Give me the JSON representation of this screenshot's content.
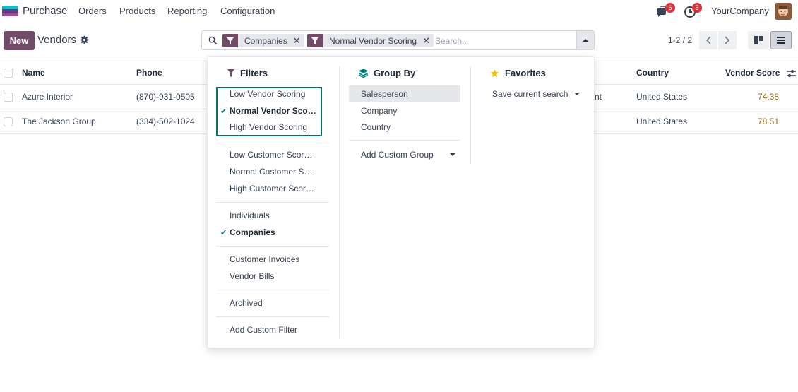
{
  "nav": {
    "app_name": "Purchase",
    "menu": [
      "Orders",
      "Products",
      "Reporting",
      "Configuration"
    ],
    "messages_count": "6",
    "activities_count": "5",
    "company": "YourCompany"
  },
  "control": {
    "new_label": "New",
    "title": "Vendors",
    "facets": [
      "Companies",
      "Normal Vendor Scoring"
    ],
    "search_placeholder": "Search...",
    "pager": "1-2 / 2"
  },
  "list": {
    "columns": [
      "Name",
      "Phone",
      "Country",
      "Vendor Score"
    ],
    "rows": [
      {
        "name": "Azure Interior",
        "phone": "(870)-931-0505",
        "hidden_partial": "nt",
        "country": "United States",
        "score": "74.38"
      },
      {
        "name": "The Jackson Group",
        "phone": "(334)-502-1024",
        "hidden_partial": "",
        "country": "United States",
        "score": "78.51"
      }
    ]
  },
  "dropdown": {
    "filters_title": "Filters",
    "filters": {
      "vendor": [
        "Low Vendor Scoring",
        "Normal Vendor Sco…",
        "High Vendor Scoring"
      ],
      "customer": [
        "Low Customer Scor…",
        "Normal Customer S…",
        "High Customer Scor…"
      ],
      "type": [
        "Individuals",
        "Companies"
      ],
      "docs": [
        "Customer Invoices",
        "Vendor Bills"
      ],
      "archived": "Archived",
      "add_custom": "Add Custom Filter"
    },
    "groupby_title": "Group By",
    "groupby": [
      "Salesperson",
      "Company",
      "Country"
    ],
    "add_custom_group": "Add Custom Group",
    "favorites_title": "Favorites",
    "save_search": "Save current search"
  },
  "colors": {
    "brand": "#714b67",
    "check": "#017e84",
    "highlight": "#0b6e6e",
    "badge": "#d9363e",
    "score": "#9a6a1a"
  }
}
